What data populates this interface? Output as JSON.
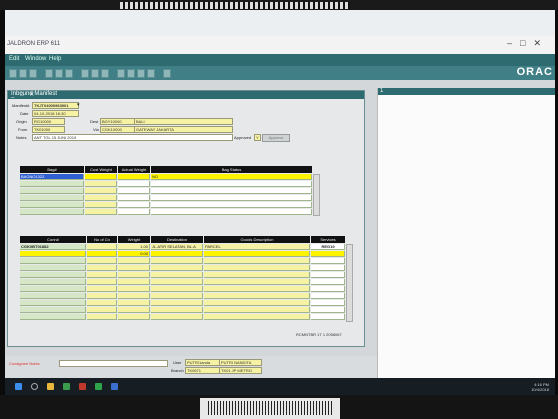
{
  "app": {
    "title": "JALDRON ERP 611",
    "menu": [
      "Edit",
      "Window",
      "Help"
    ],
    "brand": "ORAC",
    "form_title": "Inbound Manifest",
    "pane_title": "1"
  },
  "header": {
    "manifest_no_label": "Manifest#",
    "manifest_no": "TKJT04000963901",
    "date_label": "Date",
    "date_value": "04-10-2018 16:30",
    "origin_label": "Origin",
    "origin_code": "RG10000",
    "dest_label": "Dest",
    "dest_code": "BGY10000",
    "dest_name": "BALI",
    "from_label": "From",
    "from_code": "TK01000",
    "via_label": "Via",
    "via_code": "CGK10000",
    "via_name": "GATEWAY JAKARTA",
    "notes_label": "Notes",
    "notes_value": "ANT TGL 15 JUNI 2019",
    "approve_label": "Approved",
    "approve_value": "Y",
    "approve_button": "Approve"
  },
  "bag_table": {
    "columns": [
      "Bag#",
      "Cust Weight",
      "Actual Weight",
      "Bag Status"
    ],
    "rows": [
      {
        "bag": "BAGNO1322",
        "cust": "",
        "actual": "",
        "status": "NO"
      }
    ]
  },
  "conn_table": {
    "columns": [
      "Conn#",
      "No of Cn",
      "Weight",
      "Destination",
      "Goods Description",
      "Services"
    ],
    "rows": [
      {
        "conn": "CGK0BT01882",
        "cn": "",
        "weight": "1.00",
        "dest": "JL.ATIR SELATAN, BL.A",
        "goods": "PARCEL",
        "svc": "REG19"
      },
      {
        "conn": "",
        "cn": "",
        "weight": "0.00",
        "dest": "",
        "goods": "",
        "svc": ""
      }
    ]
  },
  "form_footer": {
    "record_info": "RCMNTBR 1T 1 2056067"
  },
  "status_area": {
    "error_label": "Consignee Notes",
    "user_label": "User",
    "user_code": "PUTRI1anda",
    "user_name": "PUTRI NANDITA",
    "branch_label": "Branch",
    "branch_code": "TK0671",
    "branch_name": "TK01 JP METRO"
  },
  "taskbar": {
    "time": "4:16 PM",
    "date": "10/4/2018"
  },
  "colors": {
    "teal": "#2e6b71",
    "field_yellow": "#f6f2a3",
    "grid_green": "#d6e7c8",
    "highlight": "#fff400"
  }
}
